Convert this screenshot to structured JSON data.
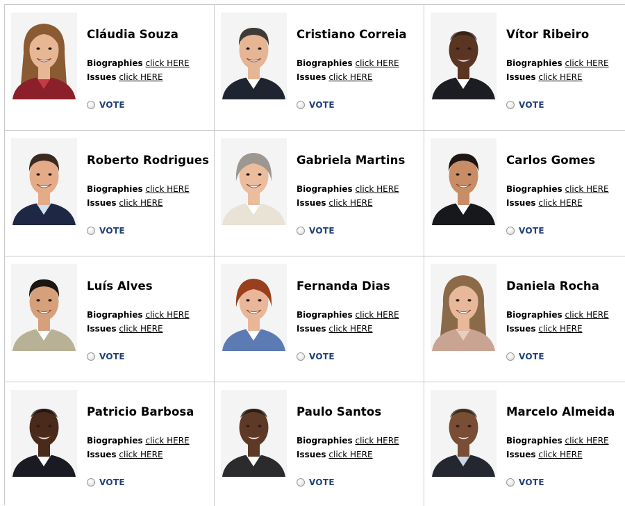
{
  "labels": {
    "biographies": "Biographies",
    "issues": "Issues",
    "link": "click HERE",
    "vote": "VOTE"
  },
  "candidates": [
    {
      "name": "Cláudia Souza",
      "skin": "#e7b795",
      "hair": "#8a5a33",
      "shirt": "#8b1f2a",
      "collar": "#c43a45",
      "hair_style": "long"
    },
    {
      "name": "Cristiano Correia",
      "skin": "#e6b594",
      "hair": "#3f3a36",
      "shirt": "#1f2530",
      "collar": "#ffffff",
      "hair_style": "short"
    },
    {
      "name": "Vítor Ribeiro",
      "skin": "#5a3522",
      "hair": "#2a1a12",
      "shirt": "#1b1d22",
      "collar": "#ffffff",
      "hair_style": "bald"
    },
    {
      "name": "Roberto Rodrigues",
      "skin": "#e3ab88",
      "hair": "#3a2a20",
      "shirt": "#1e2744",
      "collar": "#cfe0f2",
      "hair_style": "short"
    },
    {
      "name": "Gabriela Martins",
      "skin": "#ebbd9c",
      "hair": "#9c9790",
      "shirt": "#e9e3d6",
      "collar": "#ffffff",
      "hair_style": "bob"
    },
    {
      "name": "Carlos Gomes",
      "skin": "#c98d66",
      "hair": "#1d1714",
      "shirt": "#16181c",
      "collar": "#ffffff",
      "hair_style": "short"
    },
    {
      "name": "Luís Alves",
      "skin": "#d6a07a",
      "hair": "#1c1613",
      "shirt": "#b9b196",
      "collar": "#ffffff",
      "hair_style": "short"
    },
    {
      "name": "Fernanda Dias",
      "skin": "#eab69a",
      "hair": "#9a3f1d",
      "shirt": "#5d7bb3",
      "collar": "#ffffff",
      "hair_style": "bob"
    },
    {
      "name": "Daniela Rocha",
      "skin": "#e8b89a",
      "hair": "#8b6a4a",
      "shirt": "#c9a493",
      "collar": "#e6cfc2",
      "hair_style": "long"
    },
    {
      "name": "Patricio Barbosa",
      "skin": "#4a2a1b",
      "hair": "#1a100b",
      "shirt": "#1a1b22",
      "collar": "#ffffff",
      "hair_style": "bald"
    },
    {
      "name": "Paulo Santos",
      "skin": "#5e3a26",
      "hair": "#1a110c",
      "shirt": "#2b2b2d",
      "collar": "#ffffff",
      "hair_style": "bald"
    },
    {
      "name": "Marcelo Almeida",
      "skin": "#7a4e35",
      "hair": "#2a1c14",
      "shirt": "#242630",
      "collar": "#c8d6e8",
      "hair_style": "bald"
    }
  ]
}
